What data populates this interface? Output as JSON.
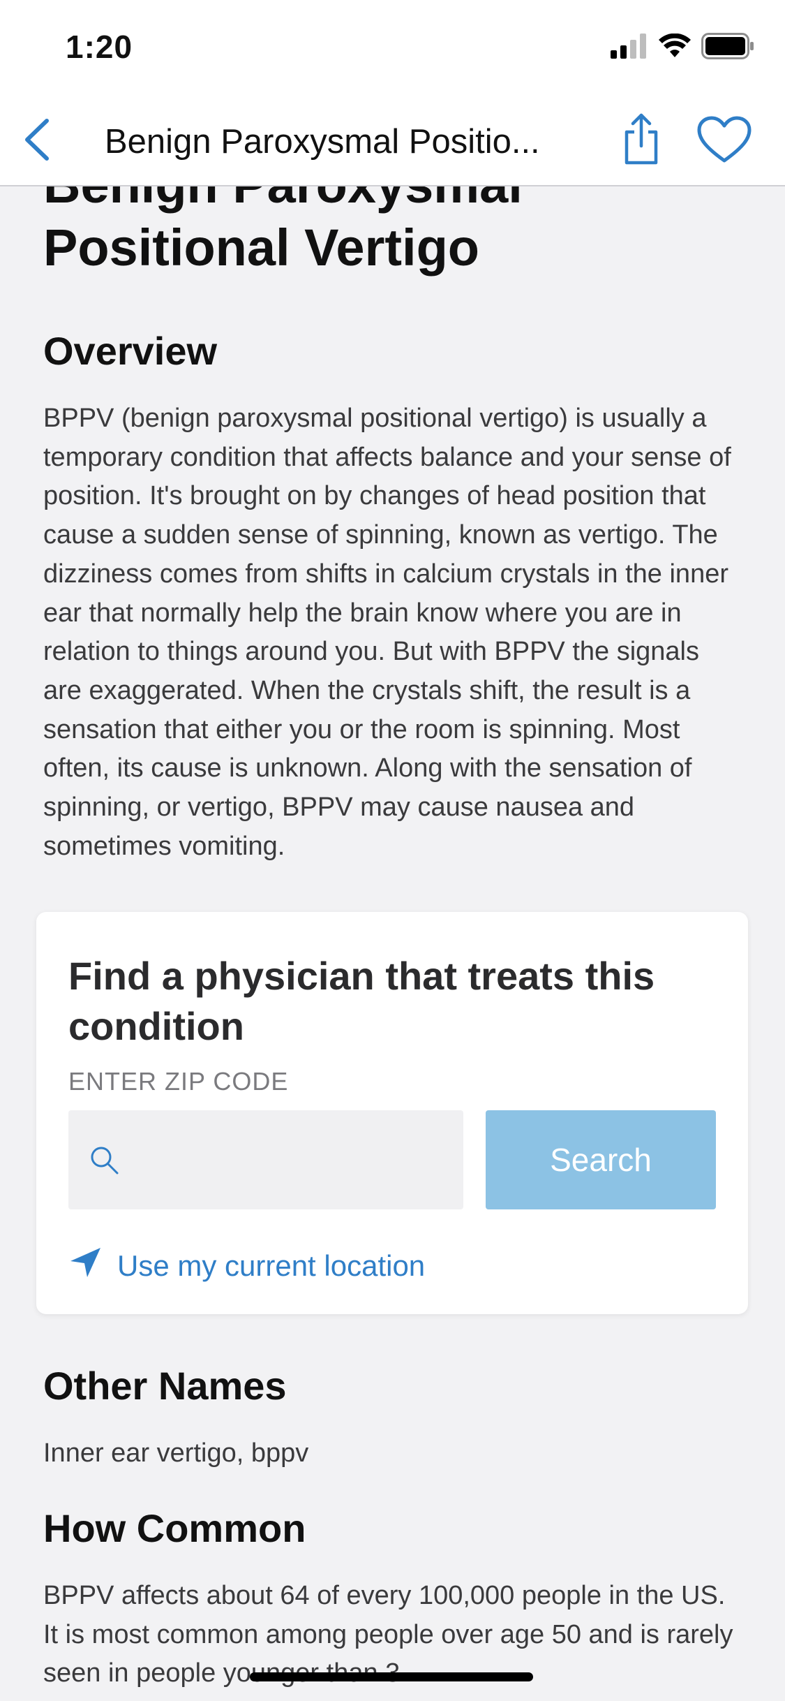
{
  "status_bar": {
    "time": "1:20"
  },
  "nav": {
    "title": "Benign Paroxysmal Positio..."
  },
  "article": {
    "title": "Benign Paroxysmal Positional Vertigo",
    "overview_heading": "Overview",
    "overview_text": "BPPV (benign paroxysmal positional vertigo) is usually a temporary condition that affects balance and your sense of position. It's brought on by changes of head position that cause a sudden sense of spinning, known as vertigo. The dizziness comes from shifts in calcium crystals in the inner ear that normally help the brain know where you are in relation to things around you. But with BPPV the signals are exaggerated. When the crystals shift, the result is a sensation that either you or the room is spinning. Most often, its cause is unknown. Along with the sensation of spinning, or vertigo, BPPV may cause nausea and sometimes vomiting.",
    "other_names_heading": "Other Names",
    "other_names_text": "Inner ear vertigo, bppv",
    "how_common_heading": "How Common",
    "how_common_text": "BPPV affects about  64 of every 100,000 people in the US. It is most common among people over age 50 and is rarely seen in people younger than 3"
  },
  "physician_card": {
    "title": "Find a physician that treats this condition",
    "zip_label": "ENTER ZIP CODE",
    "zip_value": "",
    "search_label": "Search",
    "location_link": "Use my current location"
  },
  "colors": {
    "accent": "#2f7ec7",
    "search_button": "#8cc2e4"
  },
  "icons": {
    "back": "chevron-left-icon",
    "share": "share-icon",
    "favorite": "heart-icon",
    "search": "search-icon",
    "location": "location-arrow-icon"
  }
}
